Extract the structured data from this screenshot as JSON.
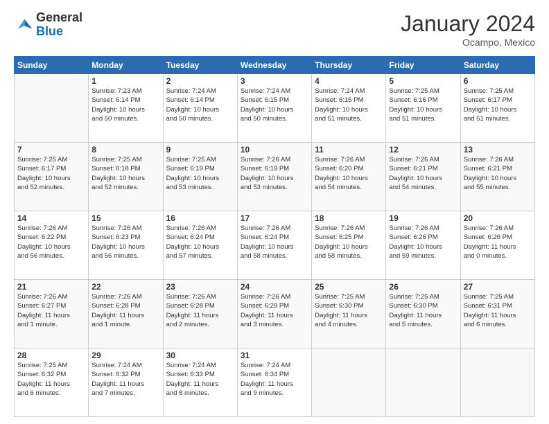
{
  "header": {
    "logo_text_general": "General",
    "logo_text_blue": "Blue",
    "month_year": "January 2024",
    "location": "Ocampo, Mexico"
  },
  "days_of_week": [
    "Sunday",
    "Monday",
    "Tuesday",
    "Wednesday",
    "Thursday",
    "Friday",
    "Saturday"
  ],
  "weeks": [
    [
      {
        "day": "",
        "info": ""
      },
      {
        "day": "1",
        "info": "Sunrise: 7:23 AM\nSunset: 6:14 PM\nDaylight: 10 hours\nand 50 minutes."
      },
      {
        "day": "2",
        "info": "Sunrise: 7:24 AM\nSunset: 6:14 PM\nDaylight: 10 hours\nand 50 minutes."
      },
      {
        "day": "3",
        "info": "Sunrise: 7:24 AM\nSunset: 6:15 PM\nDaylight: 10 hours\nand 50 minutes."
      },
      {
        "day": "4",
        "info": "Sunrise: 7:24 AM\nSunset: 6:15 PM\nDaylight: 10 hours\nand 51 minutes."
      },
      {
        "day": "5",
        "info": "Sunrise: 7:25 AM\nSunset: 6:16 PM\nDaylight: 10 hours\nand 51 minutes."
      },
      {
        "day": "6",
        "info": "Sunrise: 7:25 AM\nSunset: 6:17 PM\nDaylight: 10 hours\nand 51 minutes."
      }
    ],
    [
      {
        "day": "7",
        "info": "Sunrise: 7:25 AM\nSunset: 6:17 PM\nDaylight: 10 hours\nand 52 minutes."
      },
      {
        "day": "8",
        "info": "Sunrise: 7:25 AM\nSunset: 6:18 PM\nDaylight: 10 hours\nand 52 minutes."
      },
      {
        "day": "9",
        "info": "Sunrise: 7:25 AM\nSunset: 6:19 PM\nDaylight: 10 hours\nand 53 minutes."
      },
      {
        "day": "10",
        "info": "Sunrise: 7:26 AM\nSunset: 6:19 PM\nDaylight: 10 hours\nand 53 minutes."
      },
      {
        "day": "11",
        "info": "Sunrise: 7:26 AM\nSunset: 6:20 PM\nDaylight: 10 hours\nand 54 minutes."
      },
      {
        "day": "12",
        "info": "Sunrise: 7:26 AM\nSunset: 6:21 PM\nDaylight: 10 hours\nand 54 minutes."
      },
      {
        "day": "13",
        "info": "Sunrise: 7:26 AM\nSunset: 6:21 PM\nDaylight: 10 hours\nand 55 minutes."
      }
    ],
    [
      {
        "day": "14",
        "info": "Sunrise: 7:26 AM\nSunset: 6:22 PM\nDaylight: 10 hours\nand 56 minutes."
      },
      {
        "day": "15",
        "info": "Sunrise: 7:26 AM\nSunset: 6:23 PM\nDaylight: 10 hours\nand 56 minutes."
      },
      {
        "day": "16",
        "info": "Sunrise: 7:26 AM\nSunset: 6:24 PM\nDaylight: 10 hours\nand 57 minutes."
      },
      {
        "day": "17",
        "info": "Sunrise: 7:26 AM\nSunset: 6:24 PM\nDaylight: 10 hours\nand 58 minutes."
      },
      {
        "day": "18",
        "info": "Sunrise: 7:26 AM\nSunset: 6:25 PM\nDaylight: 10 hours\nand 58 minutes."
      },
      {
        "day": "19",
        "info": "Sunrise: 7:26 AM\nSunset: 6:26 PM\nDaylight: 10 hours\nand 59 minutes."
      },
      {
        "day": "20",
        "info": "Sunrise: 7:26 AM\nSunset: 6:26 PM\nDaylight: 11 hours\nand 0 minutes."
      }
    ],
    [
      {
        "day": "21",
        "info": "Sunrise: 7:26 AM\nSunset: 6:27 PM\nDaylight: 11 hours\nand 1 minute."
      },
      {
        "day": "22",
        "info": "Sunrise: 7:26 AM\nSunset: 6:28 PM\nDaylight: 11 hours\nand 1 minute."
      },
      {
        "day": "23",
        "info": "Sunrise: 7:26 AM\nSunset: 6:28 PM\nDaylight: 11 hours\nand 2 minutes."
      },
      {
        "day": "24",
        "info": "Sunrise: 7:26 AM\nSunset: 6:29 PM\nDaylight: 11 hours\nand 3 minutes."
      },
      {
        "day": "25",
        "info": "Sunrise: 7:25 AM\nSunset: 6:30 PM\nDaylight: 11 hours\nand 4 minutes."
      },
      {
        "day": "26",
        "info": "Sunrise: 7:25 AM\nSunset: 6:30 PM\nDaylight: 11 hours\nand 5 minutes."
      },
      {
        "day": "27",
        "info": "Sunrise: 7:25 AM\nSunset: 6:31 PM\nDaylight: 11 hours\nand 6 minutes."
      }
    ],
    [
      {
        "day": "28",
        "info": "Sunrise: 7:25 AM\nSunset: 6:32 PM\nDaylight: 11 hours\nand 6 minutes."
      },
      {
        "day": "29",
        "info": "Sunrise: 7:24 AM\nSunset: 6:32 PM\nDaylight: 11 hours\nand 7 minutes."
      },
      {
        "day": "30",
        "info": "Sunrise: 7:24 AM\nSunset: 6:33 PM\nDaylight: 11 hours\nand 8 minutes."
      },
      {
        "day": "31",
        "info": "Sunrise: 7:24 AM\nSunset: 6:34 PM\nDaylight: 11 hours\nand 9 minutes."
      },
      {
        "day": "",
        "info": ""
      },
      {
        "day": "",
        "info": ""
      },
      {
        "day": "",
        "info": ""
      }
    ]
  ]
}
